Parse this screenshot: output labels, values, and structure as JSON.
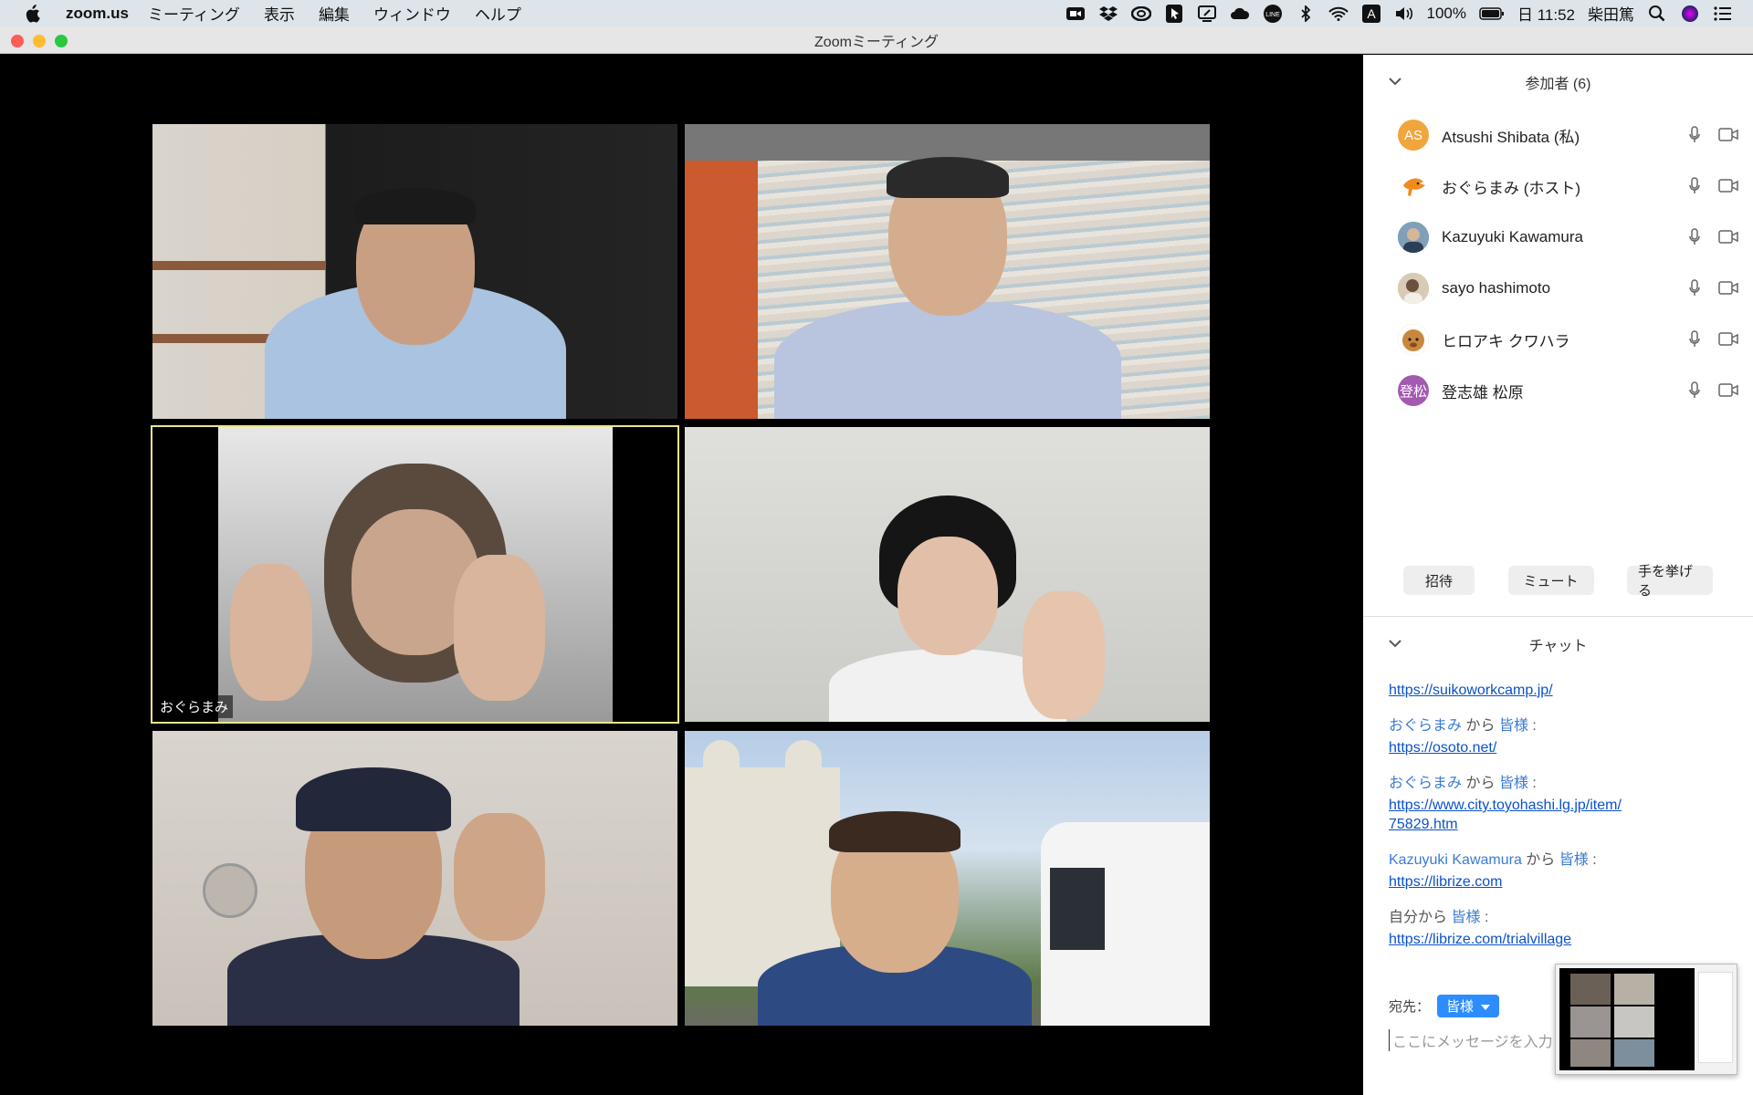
{
  "menubar": {
    "app_name": "zoom.us",
    "items": [
      "ミーティング",
      "表示",
      "編集",
      "ウィンドウ",
      "ヘルプ"
    ],
    "battery": "100%",
    "clock": "日 11:52",
    "user": "柴田篤"
  },
  "window": {
    "title": "Zoomミーティング"
  },
  "video": {
    "active_speaker_name": "おぐらまみ",
    "highlight_color": "#e9e78a"
  },
  "participants": {
    "header": "参加者 (6)",
    "list": [
      {
        "name": "Atsushi Shibata (私)",
        "initials": "AS",
        "avatar_color": "#f0a63c"
      },
      {
        "name": "おぐらまみ (ホスト)",
        "initials": "",
        "avatar_color": "#ffffff"
      },
      {
        "name": "Kazuyuki Kawamura",
        "initials": "",
        "avatar_color": "#5e7f99"
      },
      {
        "name": "sayo hashimoto",
        "initials": "",
        "avatar_color": "#b9a58a"
      },
      {
        "name": "ヒロアキ クワハラ",
        "initials": "",
        "avatar_color": "#c9883e"
      },
      {
        "name": "登志雄 松原",
        "initials": "登松",
        "avatar_color": "#a35ab0"
      }
    ],
    "buttons": {
      "invite": "招待",
      "mute": "ミュート",
      "raise_hand": "手を挙げる"
    }
  },
  "chat": {
    "header": "チャット",
    "first_link": "https://suikoworkcamp.jp/",
    "messages": [
      {
        "sender": "おぐらまみ",
        "from": "から",
        "to": "皆様",
        "colon": ":",
        "lines": [
          "https://osoto.net/"
        ]
      },
      {
        "sender": "おぐらまみ",
        "from": "から",
        "to": "皆様",
        "colon": ":",
        "lines": [
          "https://www.city.toyohashi.lg.jp/item/",
          "75829.htm"
        ]
      },
      {
        "sender": "Kazuyuki Kawamura",
        "from": "から",
        "to": "皆様",
        "colon": ":",
        "lines": [
          "https://librize.com"
        ]
      },
      {
        "sender": "自分",
        "from": "から",
        "to": "皆様",
        "colon": ":",
        "lines": [
          "https://librize.com/trialvillage"
        ]
      }
    ],
    "to_label": "宛先：",
    "to_value": "皆様",
    "input_placeholder": "ここにメッセージを入力"
  }
}
